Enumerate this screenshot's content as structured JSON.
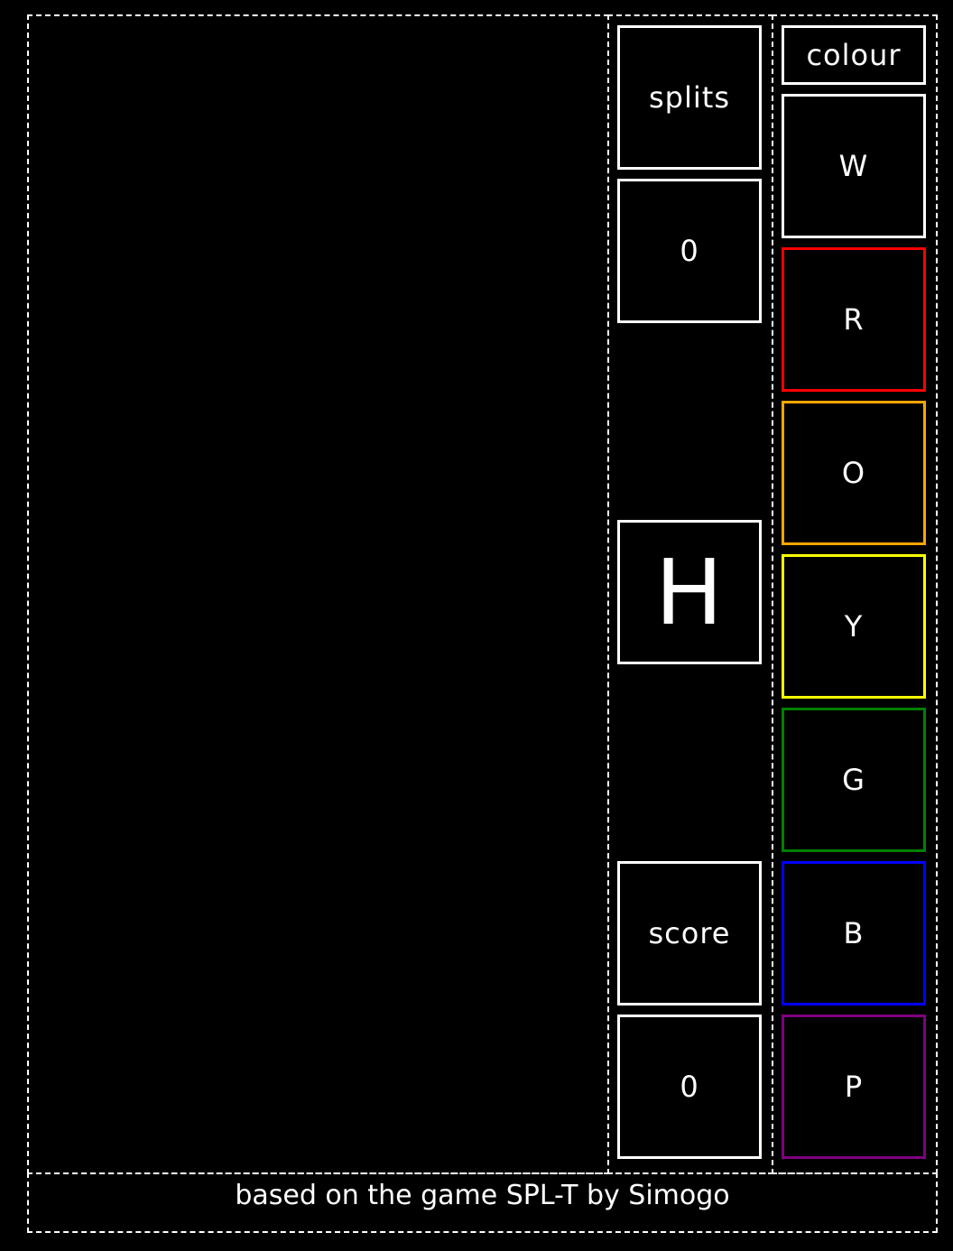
{
  "info": {
    "splits_label": "splits",
    "splits_value": "0",
    "split_direction": "H",
    "score_label": "score",
    "score_value": "0"
  },
  "colours": {
    "label": "colour",
    "buttons": [
      {
        "label": "W",
        "color": "#ffffff"
      },
      {
        "label": "R",
        "color": "#ff0000"
      },
      {
        "label": "O",
        "color": "#ffa500"
      },
      {
        "label": "Y",
        "color": "#ffff00"
      },
      {
        "label": "G",
        "color": "#008000"
      },
      {
        "label": "B",
        "color": "#0000ff"
      },
      {
        "label": "P",
        "color": "#800080"
      }
    ]
  },
  "footer": {
    "text": "based on the game SPL-T by Simogo"
  }
}
